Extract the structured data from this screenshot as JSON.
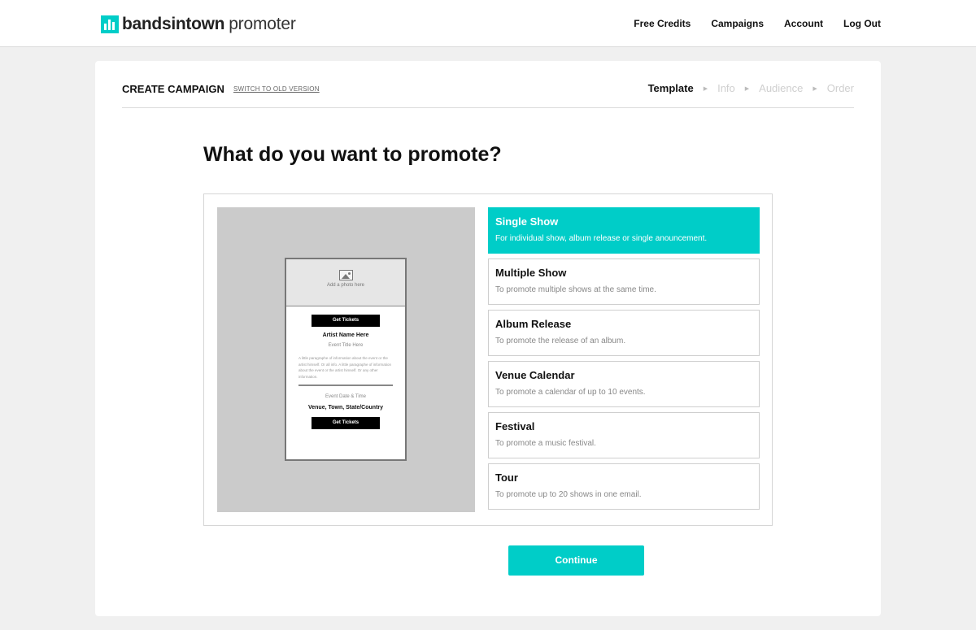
{
  "brand": {
    "name": "bandsintown",
    "product": "promoter"
  },
  "nav": {
    "items": [
      "Free Credits",
      "Campaigns",
      "Account",
      "Log Out"
    ]
  },
  "header": {
    "title": "CREATE CAMPAIGN",
    "switch_link": "SWITCH TO OLD VERSION",
    "steps": [
      {
        "label": "Template",
        "active": true
      },
      {
        "label": "Info",
        "active": false
      },
      {
        "label": "Audience",
        "active": false
      },
      {
        "label": "Order",
        "active": false
      }
    ]
  },
  "page": {
    "heading": "What do you want to promote?"
  },
  "preview": {
    "photo_label": "Add a photo here",
    "button_label": "Get Tickets",
    "artist": "Artist Name Here",
    "event_title": "Event Title Here",
    "paragraph": "A little paragraphe of information about the event or the artist himself. Or all info. A little paragraphe of information about the event or the artist himself. Or any other information.",
    "date_time": "Event Date & Time",
    "venue": "Venue, Town, State/Country"
  },
  "options": [
    {
      "title": "Single Show",
      "desc": "For individual show, album release or single anouncement.",
      "selected": true
    },
    {
      "title": "Multiple Show",
      "desc": "To promote multiple shows at the same time.",
      "selected": false
    },
    {
      "title": "Album Release",
      "desc": "To promote the release of an album.",
      "selected": false
    },
    {
      "title": "Venue Calendar",
      "desc": "To promote a calendar of up to 10 events.",
      "selected": false
    },
    {
      "title": "Festival",
      "desc": "To promote a music festival.",
      "selected": false
    },
    {
      "title": "Tour",
      "desc": "To promote up to 20 shows in one email.",
      "selected": false
    }
  ],
  "continue_label": "Continue",
  "colors": {
    "accent": "#00cdc8",
    "preview_bg": "#cbcbcb",
    "page_bg": "#f0f0f0"
  }
}
